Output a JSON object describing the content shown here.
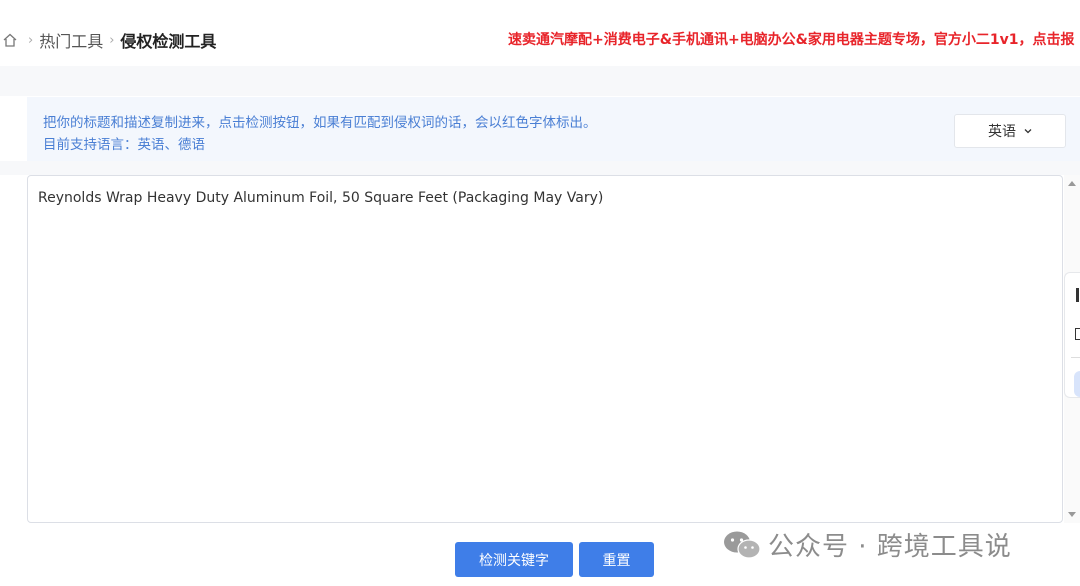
{
  "breadcrumb": {
    "items": [
      "热门工具",
      "侵权检测工具"
    ]
  },
  "banner": {
    "text": "速卖通汽摩配+消费电子&手机通讯+电脑办公&家用电器主题专场，官方小二1v1，点击报"
  },
  "info": {
    "line1": "把你的标题和描述复制进来，点击检测按钮，如果有匹配到侵权词的话，会以红色字体标出。",
    "line2": "目前支持语言：英语、德语"
  },
  "language_select": {
    "value": "英语"
  },
  "editor": {
    "value": "Reynolds Wrap Heavy Duty Aluminum Foil, 50 Square Feet (Packaging May Vary)"
  },
  "actions": {
    "detect_label": "检测关键字",
    "reset_label": "重置"
  },
  "watermark": {
    "text": "公众号 · 跨境工具说"
  },
  "colors": {
    "accent": "#3f7ee8",
    "banner": "#e8242a",
    "info_text": "#4a7fd4"
  },
  "icons": [
    "home-icon",
    "chevron-right-icon",
    "chevron-down-icon",
    "wechat-icon"
  ]
}
